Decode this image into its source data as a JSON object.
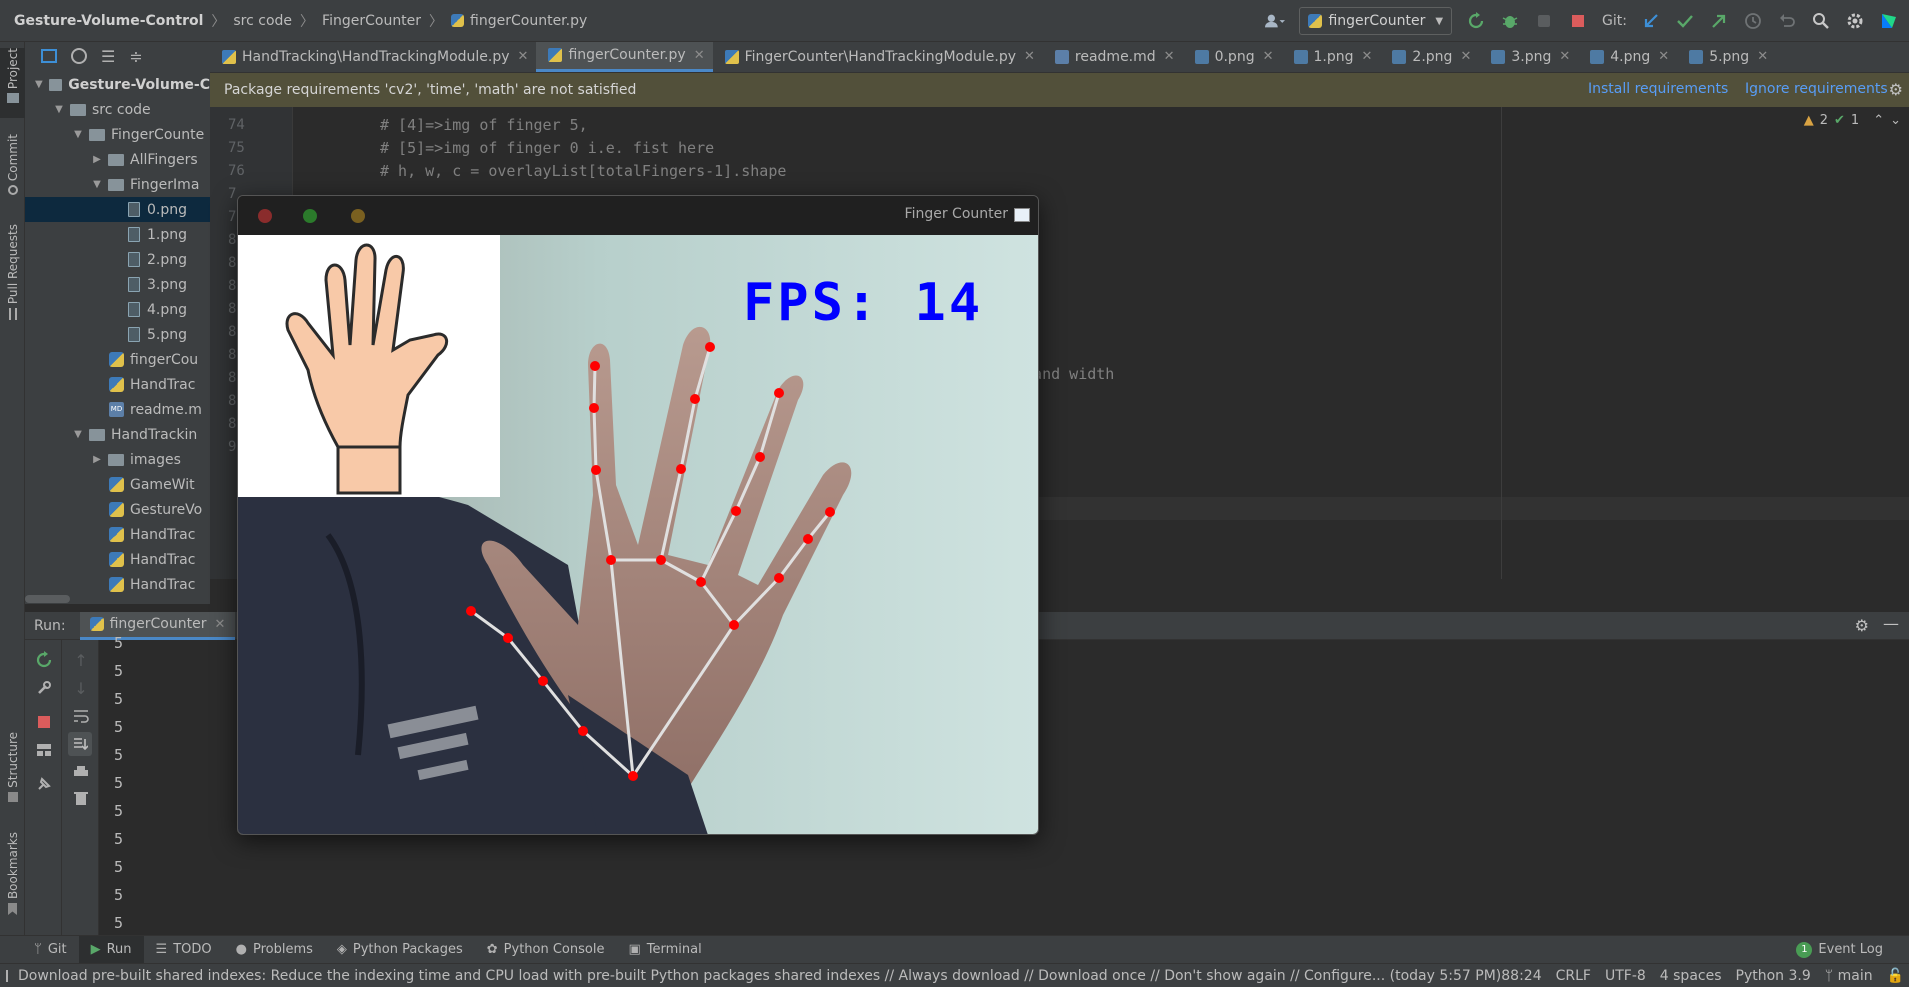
{
  "breadcrumb": {
    "project": "Gesture-Volume-Control",
    "items": [
      "src code",
      "FingerCounter",
      "fingerCounter.py"
    ]
  },
  "toolbar": {
    "run_config": "fingerCounter",
    "git_label": "Git:"
  },
  "project_tree": [
    {
      "label": "Gesture-Volume-C",
      "kind": "folder",
      "depth": 0,
      "open": true,
      "bold": true
    },
    {
      "label": "src code",
      "kind": "folder",
      "depth": 1,
      "open": true
    },
    {
      "label": "FingerCounte",
      "kind": "folder",
      "depth": 2,
      "open": true
    },
    {
      "label": "AllFingers",
      "kind": "folder",
      "depth": 3,
      "open": false
    },
    {
      "label": "FingerIma",
      "kind": "folder",
      "depth": 3,
      "open": true
    },
    {
      "label": "0.png",
      "kind": "file",
      "depth": 5,
      "selected": true
    },
    {
      "label": "1.png",
      "kind": "file",
      "depth": 5
    },
    {
      "label": "2.png",
      "kind": "file",
      "depth": 5
    },
    {
      "label": "3.png",
      "kind": "file",
      "depth": 5
    },
    {
      "label": "4.png",
      "kind": "file",
      "depth": 5
    },
    {
      "label": "5.png",
      "kind": "file",
      "depth": 5
    },
    {
      "label": "fingerCou",
      "kind": "py",
      "depth": 4
    },
    {
      "label": "HandTrac",
      "kind": "py",
      "depth": 4
    },
    {
      "label": "readme.m",
      "kind": "md",
      "depth": 4
    },
    {
      "label": "HandTrackin",
      "kind": "folder",
      "depth": 2,
      "open": true
    },
    {
      "label": "images",
      "kind": "folder",
      "depth": 3,
      "open": false
    },
    {
      "label": "GameWit",
      "kind": "py",
      "depth": 4
    },
    {
      "label": "GestureVo",
      "kind": "py",
      "depth": 4
    },
    {
      "label": "HandTrac",
      "kind": "py",
      "depth": 4
    },
    {
      "label": "HandTrac",
      "kind": "py",
      "depth": 4
    },
    {
      "label": "HandTrac",
      "kind": "py",
      "depth": 4
    }
  ],
  "left_tabs": {
    "project": "Project",
    "commit": "Commit",
    "pull_requests": "Pull Requests",
    "structure": "Structure",
    "bookmarks": "Bookmarks"
  },
  "tabs": [
    {
      "label": "HandTracking\\HandTrackingModule.py",
      "kind": "py"
    },
    {
      "label": "fingerCounter.py",
      "kind": "py",
      "active": true
    },
    {
      "label": "FingerCounter\\HandTrackingModule.py",
      "kind": "py"
    },
    {
      "label": "readme.md",
      "kind": "md"
    },
    {
      "label": "0.png",
      "kind": "img"
    },
    {
      "label": "1.png",
      "kind": "img"
    },
    {
      "label": "2.png",
      "kind": "img"
    },
    {
      "label": "3.png",
      "kind": "img"
    },
    {
      "label": "4.png",
      "kind": "img"
    },
    {
      "label": "5.png",
      "kind": "img"
    }
  ],
  "banner": {
    "message": "Package requirements 'cv2', 'time', 'math' are not satisfied",
    "install": "Install requirements",
    "ignore": "Ignore requirements"
  },
  "editor": {
    "line_numbers": [
      "74",
      "75",
      "76",
      "7",
      "7",
      "8",
      "8",
      "8",
      "8",
      "8",
      "8",
      "8",
      "8",
      "8",
      "9"
    ],
    "code_lines": [
      "# [4]=>img of finger 5,",
      "# [5]=>img of finger 0 i.e. fist here",
      "# h, w, c = overlayList[totalFingers-1].shape"
    ],
    "code_fragment": "t and width",
    "inspections": {
      "warnings": "2",
      "ok": "1"
    }
  },
  "run": {
    "label": "Run:",
    "tab": "fingerCounter",
    "output": [
      "5",
      "5",
      "5",
      "5",
      "5",
      "5",
      "5",
      "5",
      "5",
      "5",
      "5"
    ]
  },
  "finger_window": {
    "title": "Finger Counter",
    "fps_text": "FPS: 14"
  },
  "bottom_tools": [
    "Git",
    "Run",
    "TODO",
    "Problems",
    "Python Packages",
    "Python Console",
    "Terminal"
  ],
  "event_log": {
    "count": "1",
    "label": "Event Log"
  },
  "status": {
    "message": "Download pre-built shared indexes: Reduce the indexing time and CPU load with pre-built Python packages shared indexes // Always download // Download once // Don't show again // Configure... (today 5:57 PM)",
    "position": "88:24",
    "line_sep": "CRLF",
    "encoding": "UTF-8",
    "indent": "4 spaces",
    "interpreter": "Python 3.9",
    "branch": "main"
  },
  "colors": {
    "accent": "#4a88c7",
    "banner_bg": "#52503a",
    "fps_text": "#0000ff",
    "landmark": "#ff0000",
    "connection": "#e0e0e0"
  }
}
